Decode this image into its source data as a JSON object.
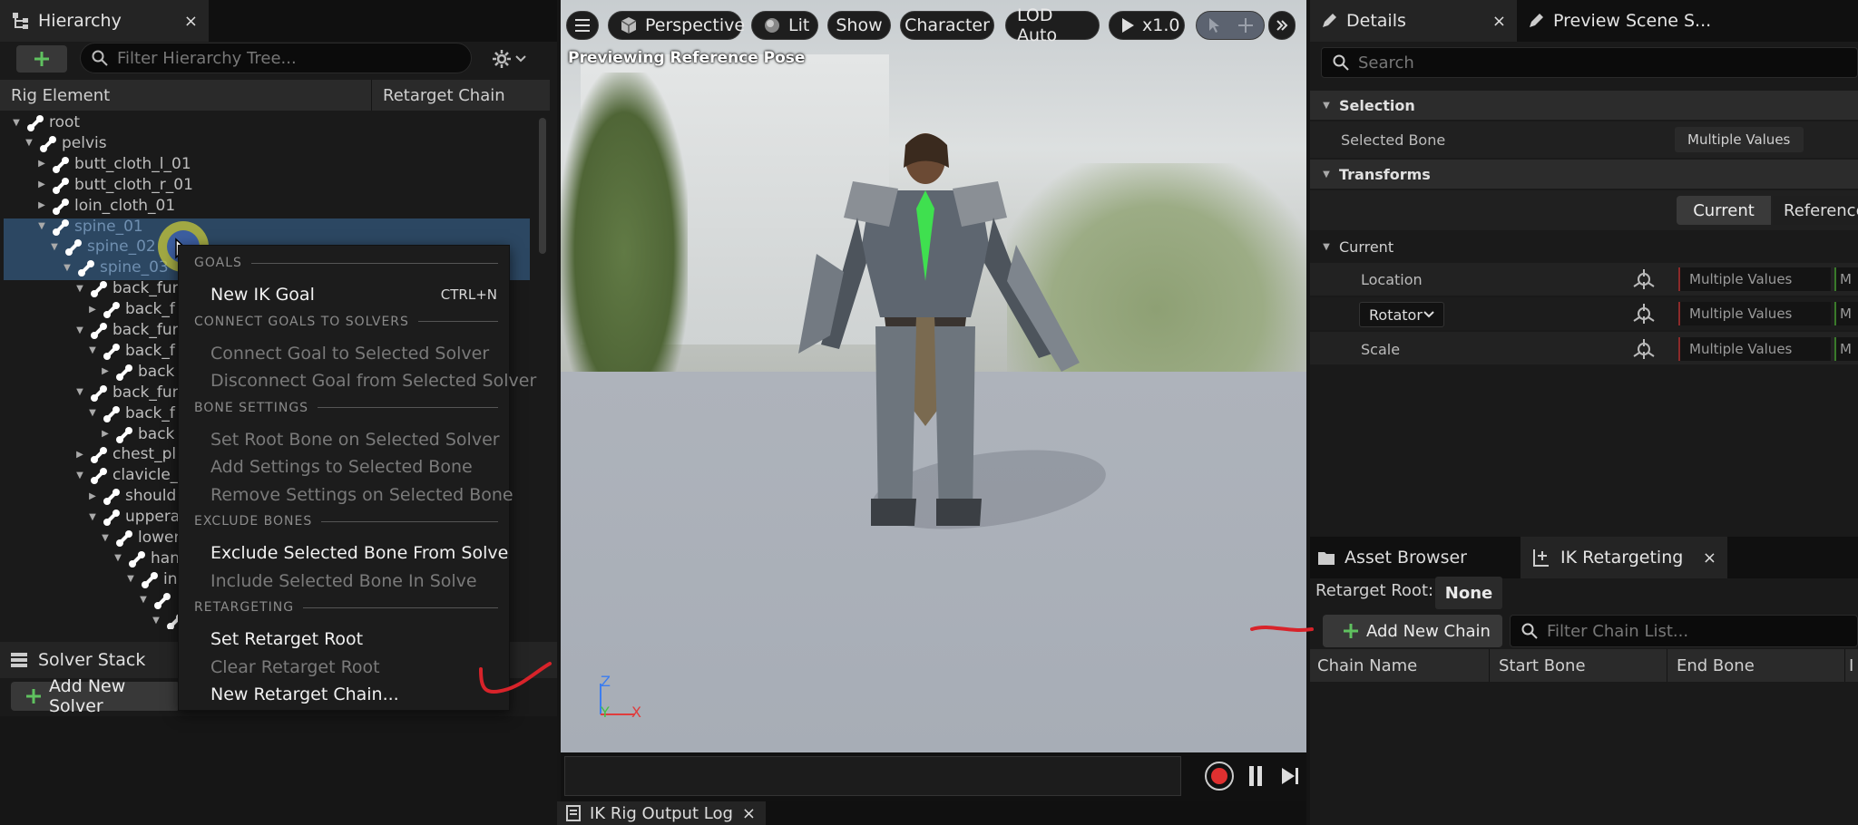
{
  "hierarchy": {
    "tab_title": "Hierarchy",
    "close": "×",
    "search_placeholder": "Filter Hierarchy Tree...",
    "col_rig_element": "Rig Element",
    "col_retarget_chain": "Retarget Chain",
    "tree": [
      {
        "label": "root",
        "depth": 0,
        "expanded": true
      },
      {
        "label": "pelvis",
        "depth": 1,
        "expanded": true
      },
      {
        "label": "butt_cloth_l_01",
        "depth": 2,
        "expanded": false
      },
      {
        "label": "butt_cloth_r_01",
        "depth": 2,
        "expanded": false
      },
      {
        "label": "loin_cloth_01",
        "depth": 2,
        "expanded": false
      },
      {
        "label": "spine_01",
        "depth": 2,
        "expanded": true,
        "selected": true
      },
      {
        "label": "spine_02",
        "depth": 3,
        "expanded": true,
        "selected": true
      },
      {
        "label": "spine_03",
        "depth": 4,
        "expanded": true,
        "selected": true
      },
      {
        "label": "back_fur",
        "depth": 5,
        "expanded": true
      },
      {
        "label": "back_f",
        "depth": 6,
        "expanded": false
      },
      {
        "label": "back_fur",
        "depth": 5,
        "expanded": true
      },
      {
        "label": "back_f",
        "depth": 6,
        "expanded": true
      },
      {
        "label": "back",
        "depth": 7,
        "expanded": false
      },
      {
        "label": "back_fur",
        "depth": 5,
        "expanded": true
      },
      {
        "label": "back_f",
        "depth": 6,
        "expanded": true
      },
      {
        "label": "back",
        "depth": 7,
        "expanded": false
      },
      {
        "label": "chest_pl",
        "depth": 5,
        "expanded": false
      },
      {
        "label": "clavicle_",
        "depth": 5,
        "expanded": true
      },
      {
        "label": "should",
        "depth": 6,
        "expanded": false
      },
      {
        "label": "upperar",
        "depth": 6,
        "expanded": true
      },
      {
        "label": "lower",
        "depth": 7,
        "expanded": true
      },
      {
        "label": "han",
        "depth": 8,
        "expanded": true
      },
      {
        "label": "in",
        "depth": 9,
        "expanded": true
      },
      {
        "label": "",
        "depth": 10,
        "expanded": true
      },
      {
        "label": "",
        "depth": 11,
        "expanded": true
      }
    ]
  },
  "context_menu": {
    "sections": [
      {
        "header": "GOALS",
        "items": [
          {
            "label": "New IK Goal",
            "shortcut": "CTRL+N",
            "enabled": true
          }
        ]
      },
      {
        "header": "CONNECT GOALS TO SOLVERS",
        "items": [
          {
            "label": "Connect Goal to Selected Solver",
            "enabled": false
          },
          {
            "label": "Disconnect Goal from Selected Solver",
            "enabled": false
          }
        ]
      },
      {
        "header": "BONE SETTINGS",
        "items": [
          {
            "label": "Set Root Bone on Selected Solver",
            "enabled": false
          },
          {
            "label": "Add Settings to Selected Bone",
            "enabled": false
          },
          {
            "label": "Remove Settings on Selected Bone",
            "enabled": false
          }
        ]
      },
      {
        "header": "EXCLUDE BONES",
        "items": [
          {
            "label": "Exclude Selected Bone From Solve",
            "enabled": true
          },
          {
            "label": "Include Selected Bone In Solve",
            "enabled": false
          }
        ]
      },
      {
        "header": "RETARGETING",
        "items": [
          {
            "label": "Set Retarget Root",
            "enabled": true
          },
          {
            "label": "Clear Retarget Root",
            "enabled": false
          },
          {
            "label": "New Retarget Chain...",
            "enabled": true
          }
        ]
      }
    ]
  },
  "solver_stack": {
    "tab_title": "Solver Stack",
    "add_button": "Add New Solver"
  },
  "viewport": {
    "perspective": "Perspective",
    "lit": "Lit",
    "show": "Show",
    "character": "Character",
    "lod": "LOD Auto",
    "play_speed": "x1.0",
    "status_text": "Previewing Reference Pose",
    "axis_z": "Z",
    "axis_y": "Y",
    "axis_x": "X",
    "colors": {
      "axis_x": "#e03c3c",
      "axis_y": "#45c145",
      "axis_z": "#3c7df0",
      "record": "#e03030"
    }
  },
  "output_log": {
    "tab_title": "IK Rig Output Log",
    "close": "×"
  },
  "details": {
    "tab_title": "Details",
    "close": "×",
    "preview_tab": "Preview Scene S...",
    "search_placeholder": "Search",
    "selection_header": "Selection",
    "selected_bone_label": "Selected Bone",
    "selected_bone_value": "Multiple Values",
    "transforms_header": "Transforms",
    "current_btn": "Current",
    "reference_btn": "Reference",
    "current_header": "Current",
    "location_label": "Location",
    "rotator_label": "Rotator",
    "scale_label": "Scale",
    "multiple_values": "Multiple Values",
    "partial_m": "M"
  },
  "retarget": {
    "asset_browser_tab": "Asset Browser",
    "ik_retargeting_tab": "IK Retargeting",
    "close": "×",
    "retarget_root_label": "Retarget Root:",
    "retarget_root_value": "None",
    "add_chain_button": "Add New Chain",
    "filter_placeholder": "Filter Chain List...",
    "col_chain_name": "Chain Name",
    "col_start_bone": "Start Bone",
    "col_end_bone": "End Bone",
    "col_partial": "I"
  },
  "accent_colors": {
    "add_green": "#5fc15f",
    "selection_blue": "#3c6e9e",
    "annotation_red": "#d8232a",
    "cursor_ring": "#c8c83a"
  }
}
